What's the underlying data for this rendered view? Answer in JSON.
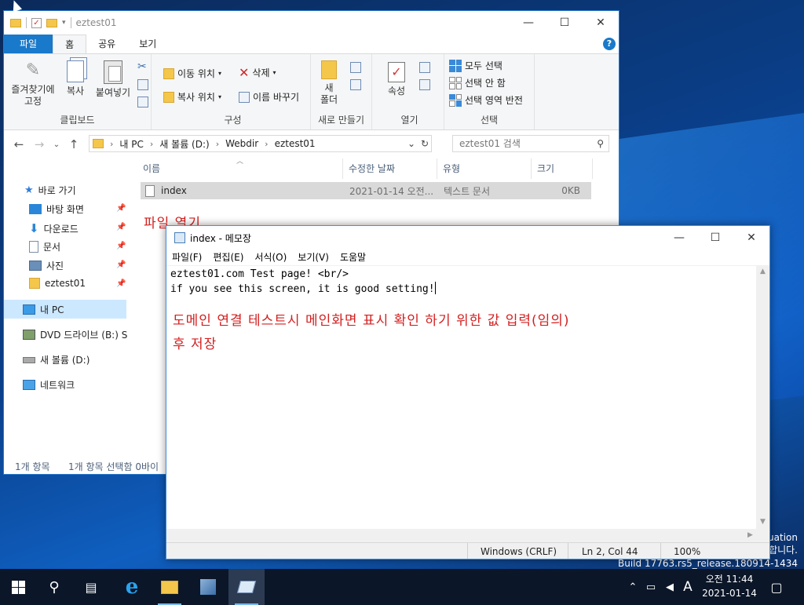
{
  "explorer": {
    "title": "eztest01",
    "controls": {
      "minimize": "—",
      "maximize": "☐",
      "close": "✕"
    },
    "tabs": [
      "파일",
      "홈",
      "공유",
      "보기"
    ],
    "ribbon": {
      "clipboard": {
        "pin": "즐겨찾기에\n고정",
        "copy": "복사",
        "paste": "붙여넣기",
        "label": "클립보드"
      },
      "organize": {
        "move_to": "이동 위치",
        "copy_to": "복사 위치",
        "delete": "삭제",
        "rename": "이름 바꾸기",
        "label": "구성"
      },
      "new": {
        "new_folder": "새\n폴더",
        "label": "새로 만들기"
      },
      "open": {
        "properties": "속성",
        "label": "열기"
      },
      "select": {
        "select_all": "모두 선택",
        "select_none": "선택 안 함",
        "invert": "선택 영역 반전",
        "label": "선택"
      }
    },
    "address": {
      "segments": [
        "내 PC",
        "새 볼륨 (D:)",
        "Webdir",
        "eztest01"
      ],
      "search_placeholder": "eztest01 검색"
    },
    "nav": {
      "quick_access": "바로 가기",
      "pinned": [
        "바탕 화면",
        "다운로드",
        "문서",
        "사진",
        "eztest01"
      ],
      "this_pc": "내 PC",
      "dvd": "DVD 드라이브 (B:) S",
      "volume": "새 볼륨 (D:)",
      "network": "네트워크"
    },
    "columns": {
      "name": "이름",
      "modified": "수정한 날짜",
      "type": "유형",
      "size": "크기"
    },
    "file": {
      "name": "index",
      "modified": "2021-01-14 오전...",
      "type": "텍스트 문서",
      "size": "0KB"
    },
    "annotation": "파일 열기",
    "status": {
      "count": "1개 항목",
      "selected": "1개 항목 선택함 0바이"
    }
  },
  "notepad": {
    "title": "index - 메모장",
    "menu": [
      "파일(F)",
      "편집(E)",
      "서식(O)",
      "보기(V)",
      "도움말"
    ],
    "line1": "eztest01.com Test page! <br/>",
    "line2": "if you see this screen, it is good setting!",
    "annotation_line1": "도메인 연결 테스트시 메인화면 표시 확인 하기 위한 값 입력(임의)",
    "annotation_line2": "후 저장",
    "status": {
      "eol": "Windows (CRLF)",
      "position": "Ln 2, Col 44",
      "zoom": "100%"
    }
  },
  "desktop": {
    "eval_line1": "uation",
    "eval_line2": "합니다.",
    "build": "Build 17763.rs5_release.180914-1434"
  },
  "taskbar": {
    "ime": "A",
    "time": "오전 11:44",
    "date": "2021-01-14"
  },
  "colors": {
    "accent": "#1979ca",
    "annotation": "#d32020",
    "taskbar": "#0b1628"
  }
}
